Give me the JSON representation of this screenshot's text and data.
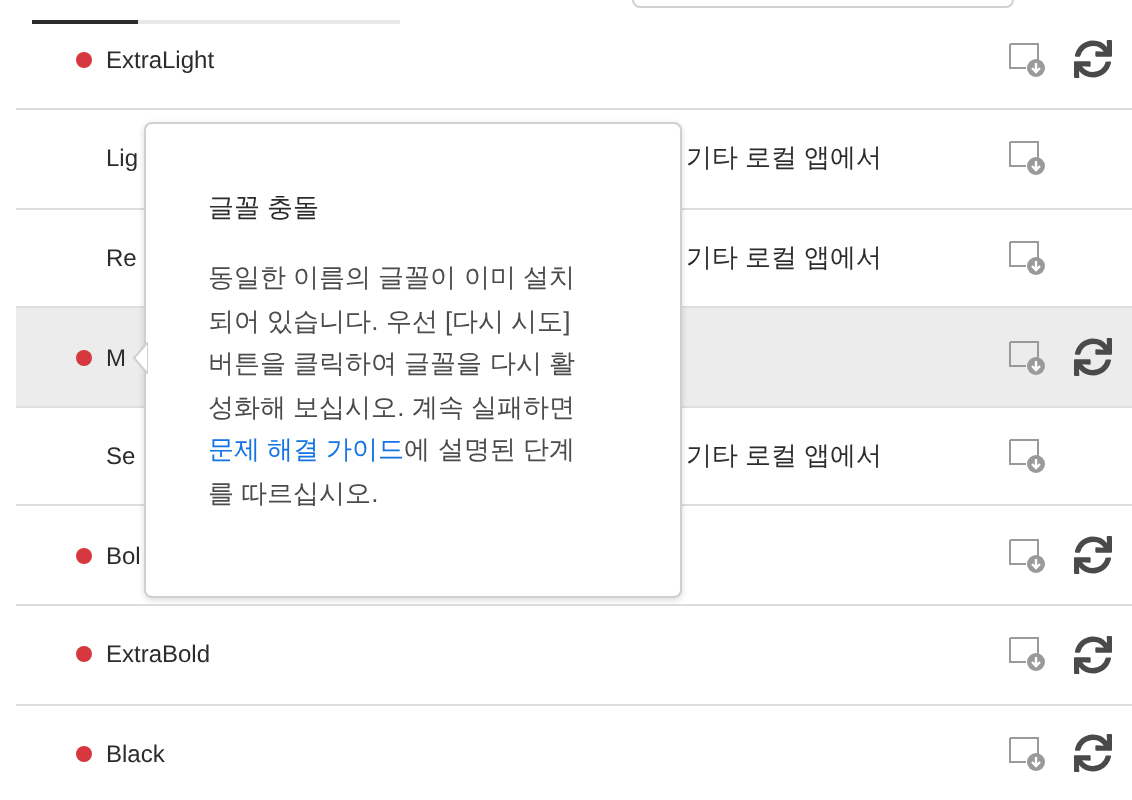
{
  "rows": [
    {
      "name": "ExtraLight",
      "error": true,
      "selected": false
    },
    {
      "name": "Lig",
      "error": false,
      "selected": false,
      "message": "기타 로컬 앱에서"
    },
    {
      "name": "Re",
      "error": false,
      "selected": false,
      "message": "기타 로컬 앱에서"
    },
    {
      "name": "M",
      "error": true,
      "selected": true
    },
    {
      "name": "Se",
      "error": false,
      "selected": false,
      "message": "기타 로컬 앱에서"
    },
    {
      "name": "Bol",
      "error": true,
      "selected": false
    },
    {
      "name": "ExtraBold",
      "error": true,
      "selected": false
    },
    {
      "name": "Black",
      "error": true,
      "selected": false
    }
  ],
  "popup": {
    "title": "글꼴 충돌",
    "body_before": "동일한 이름의 글꼴이 이미 설치되어 있습니다. 우선 [다시 시도] 버튼을 클릭하여 글꼴을 다시 활성화해 보십시오. 계속 실패하면 ",
    "link": "문제 해결 가이드",
    "body_after": "에 설명된 단계를 따르십시오."
  }
}
